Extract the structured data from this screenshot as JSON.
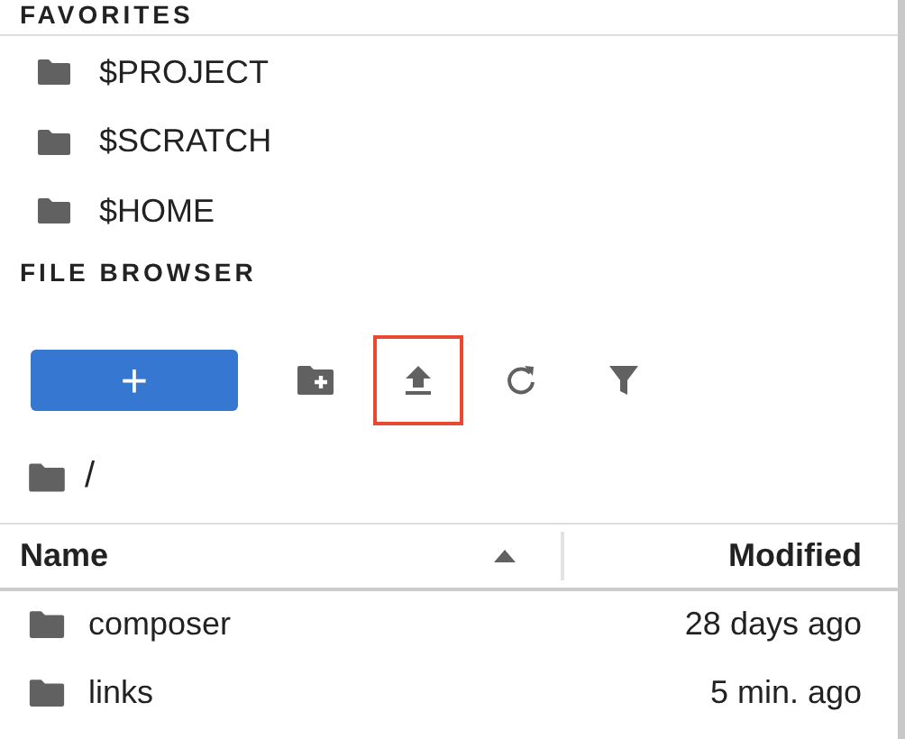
{
  "favorites": {
    "heading": "FAVORITES",
    "items": [
      {
        "label": "$PROJECT"
      },
      {
        "label": "$SCRATCH"
      },
      {
        "label": "$HOME"
      }
    ]
  },
  "file_browser": {
    "heading": "FILE BROWSER",
    "new_button": {
      "label": "+"
    },
    "toolbar": [
      {
        "kind": "new-folder",
        "highlighted": false
      },
      {
        "kind": "upload",
        "highlighted": true
      },
      {
        "kind": "refresh",
        "highlighted": false
      },
      {
        "kind": "filter",
        "highlighted": false
      }
    ],
    "breadcrumb": "/",
    "table": {
      "columns": [
        {
          "label": "Name",
          "sorted": true
        },
        {
          "label": "Modified",
          "sorted": false
        }
      ],
      "rows": [
        {
          "name": "composer",
          "modified": "28 days ago"
        },
        {
          "name": "links",
          "modified": "5 min. ago"
        }
      ]
    }
  }
}
